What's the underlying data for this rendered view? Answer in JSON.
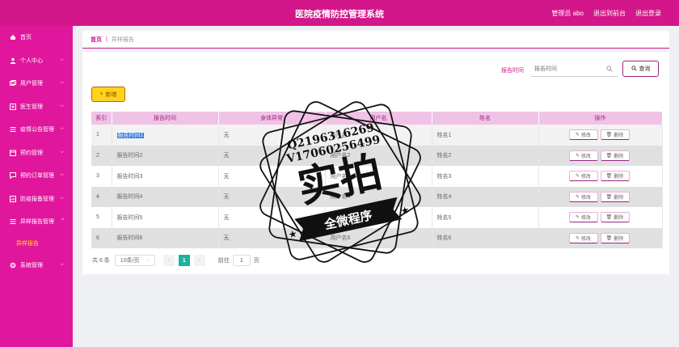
{
  "header": {
    "title": "医院疫情防控管理系统",
    "user_label": "管理员 abo",
    "front_label": "退出到前台",
    "logout_label": "退出登录"
  },
  "sidebar": {
    "items": [
      {
        "label": "首页",
        "icon": "home-icon",
        "chevron": false
      },
      {
        "label": "个人中心",
        "icon": "user-icon",
        "chevron": true
      },
      {
        "label": "用户管理",
        "icon": "users-icon",
        "chevron": true
      },
      {
        "label": "医生管理",
        "icon": "doctor-icon",
        "chevron": true
      },
      {
        "label": "疫情公告管理",
        "icon": "list-icon",
        "chevron": true
      },
      {
        "label": "预约管理",
        "icon": "calendar-icon",
        "chevron": true
      },
      {
        "label": "预约订单管理",
        "icon": "message-icon",
        "chevron": true
      },
      {
        "label": "防疫报备管理",
        "icon": "report-icon",
        "chevron": true
      },
      {
        "label": "异样报告管理",
        "icon": "menu-icon",
        "chevron": true,
        "expanded": true
      },
      {
        "label": "系统管理",
        "icon": "settings-icon",
        "chevron": true
      }
    ],
    "sub_item": "异样报告"
  },
  "breadcrumb": {
    "home": "首页",
    "separator": "|",
    "current": "异样报告"
  },
  "search": {
    "label": "报告时间",
    "placeholder": "报告时间",
    "query_label": "查询"
  },
  "toolbar": {
    "add_label": "新增"
  },
  "table": {
    "columns": [
      "索引",
      "报告时间",
      "身体异常",
      "用户名",
      "姓名",
      "操作"
    ],
    "edit_label": "修改",
    "delete_label": "删除",
    "rows": [
      {
        "index": "1",
        "time": "报告时间1",
        "abnormal": "无",
        "username": "用户名1",
        "name": "姓名1"
      },
      {
        "index": "2",
        "time": "报告时间2",
        "abnormal": "无",
        "username": "用户名2",
        "name": "姓名2"
      },
      {
        "index": "3",
        "time": "报告时间3",
        "abnormal": "无",
        "username": "用户名3",
        "name": "姓名3"
      },
      {
        "index": "4",
        "time": "报告时间4",
        "abnormal": "无",
        "username": "用户名4",
        "name": "姓名4"
      },
      {
        "index": "5",
        "time": "报告时间5",
        "abnormal": "无",
        "username": "用户名5",
        "name": "姓名5"
      },
      {
        "index": "6",
        "time": "报告时间6",
        "abnormal": "无",
        "username": "用户名6",
        "name": "姓名6"
      }
    ]
  },
  "pagination": {
    "total": "共 6 条",
    "page_size": "10条/页",
    "current_page": "1",
    "goto_label": "前往",
    "goto_value": "1",
    "page_unit": "页"
  },
  "watermark": {
    "line1": "Q2196316269",
    "line2": "V17060256499",
    "main": "实拍",
    "ribbon": "全微程序"
  },
  "colors": {
    "topbar": "#d3168a",
    "sidebar": "#e0179d",
    "accent": "#a0227f",
    "header_row": "#f0c3e6",
    "add_button": "#ffd21e",
    "active_page": "#1fb19a",
    "sub_item_text": "#ffe000"
  }
}
